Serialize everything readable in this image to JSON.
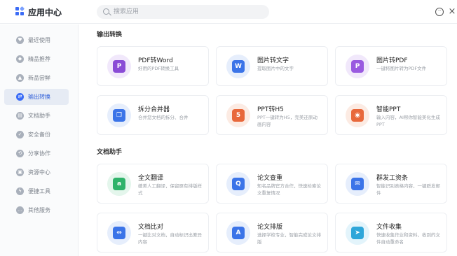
{
  "app": {
    "title": "应用中心"
  },
  "search": {
    "placeholder": "搜索应用"
  },
  "header_icons": [
    "chat-icon",
    "close-icon"
  ],
  "sidebar": {
    "items": [
      {
        "label": "最近使用",
        "icon": "heart-icon",
        "glyph": "♥",
        "active": false
      },
      {
        "label": "精品推荐",
        "icon": "diamond-icon",
        "glyph": "◆",
        "active": false
      },
      {
        "label": "新品尝鲜",
        "icon": "flame-icon",
        "glyph": "▲",
        "active": false
      },
      {
        "label": "输出转换",
        "icon": "convert-icon",
        "glyph": "⇄",
        "active": true
      },
      {
        "label": "文档助手",
        "icon": "document-icon",
        "glyph": "▤",
        "active": false
      },
      {
        "label": "安全备份",
        "icon": "shield-icon",
        "glyph": "✓",
        "active": false
      },
      {
        "label": "分享协作",
        "icon": "share-icon",
        "glyph": "⟲",
        "active": false
      },
      {
        "label": "资源中心",
        "icon": "folder-icon",
        "glyph": "▣",
        "active": false
      },
      {
        "label": "便捷工具",
        "icon": "lightning-icon",
        "glyph": "ϟ",
        "active": false
      },
      {
        "label": "其他服务",
        "icon": "more-icon",
        "glyph": "…",
        "active": false
      }
    ]
  },
  "sections": [
    {
      "title": "输出转换",
      "cards": [
        {
          "title": "PDF转Word",
          "desc": "好用的PDF转换工具",
          "icon": "pdf-to-word-icon",
          "glyph": "P",
          "bg": "#f1e8fb",
          "fg": "#8a4bd6"
        },
        {
          "title": "图片转文字",
          "desc": "提取图片中的文字",
          "icon": "image-to-text-icon",
          "glyph": "W",
          "bg": "#e6eefc",
          "fg": "#3b74e8"
        },
        {
          "title": "图片转PDF",
          "desc": "一键将图片转为PDF文件",
          "icon": "image-to-pdf-icon",
          "glyph": "P",
          "bg": "#f1e8fb",
          "fg": "#9a5ae0"
        },
        {
          "title": "拆分合并器",
          "desc": "合并您文档的拆分、合并",
          "icon": "split-merge-icon",
          "glyph": "❐",
          "bg": "#e6eefc",
          "fg": "#3b74e8"
        },
        {
          "title": "PPT转H5",
          "desc": "PPT一键转为H5，完美还原动画内容",
          "icon": "ppt-to-h5-icon",
          "glyph": "5",
          "bg": "#fcebe3",
          "fg": "#e8683b"
        },
        {
          "title": "智能PPT",
          "desc": "输入内容，AI帮你智能美化生成PPT",
          "icon": "smart-ppt-icon",
          "glyph": "◉",
          "bg": "#fcebe3",
          "fg": "#e8683b"
        }
      ]
    },
    {
      "title": "文档助手",
      "cards": [
        {
          "title": "全文翻译",
          "desc": "媲美人工翻译，保留原有排版样式",
          "icon": "translate-icon",
          "glyph": "a",
          "bg": "#e4f6ec",
          "fg": "#2fb36a"
        },
        {
          "title": "论文查重",
          "desc": "知名品牌官方合作，快速检索论文重复情况",
          "icon": "plagiarism-check-icon",
          "glyph": "Q",
          "bg": "#e6eefc",
          "fg": "#3b74e8"
        },
        {
          "title": "群发工资条",
          "desc": "智能识别表格内容，一键群发邮件",
          "icon": "payslip-icon",
          "glyph": "✉",
          "bg": "#e6eefc",
          "fg": "#3b74e8"
        },
        {
          "title": "文档比对",
          "desc": "一键比对文档，自动标识出差异内容",
          "icon": "compare-icon",
          "glyph": "⇔",
          "bg": "#e6eefc",
          "fg": "#3b74e8"
        },
        {
          "title": "论文排版",
          "desc": "选择学校专业，智能完成论文排版",
          "icon": "thesis-format-icon",
          "glyph": "A",
          "bg": "#e6eefc",
          "fg": "#3b74e8"
        },
        {
          "title": "文件收集",
          "desc": "快速收集作业和资料，收到的文件自动重命名",
          "icon": "file-collect-icon",
          "glyph": "➤",
          "bg": "#e3f4fb",
          "fg": "#2fa6d9"
        }
      ]
    }
  ]
}
